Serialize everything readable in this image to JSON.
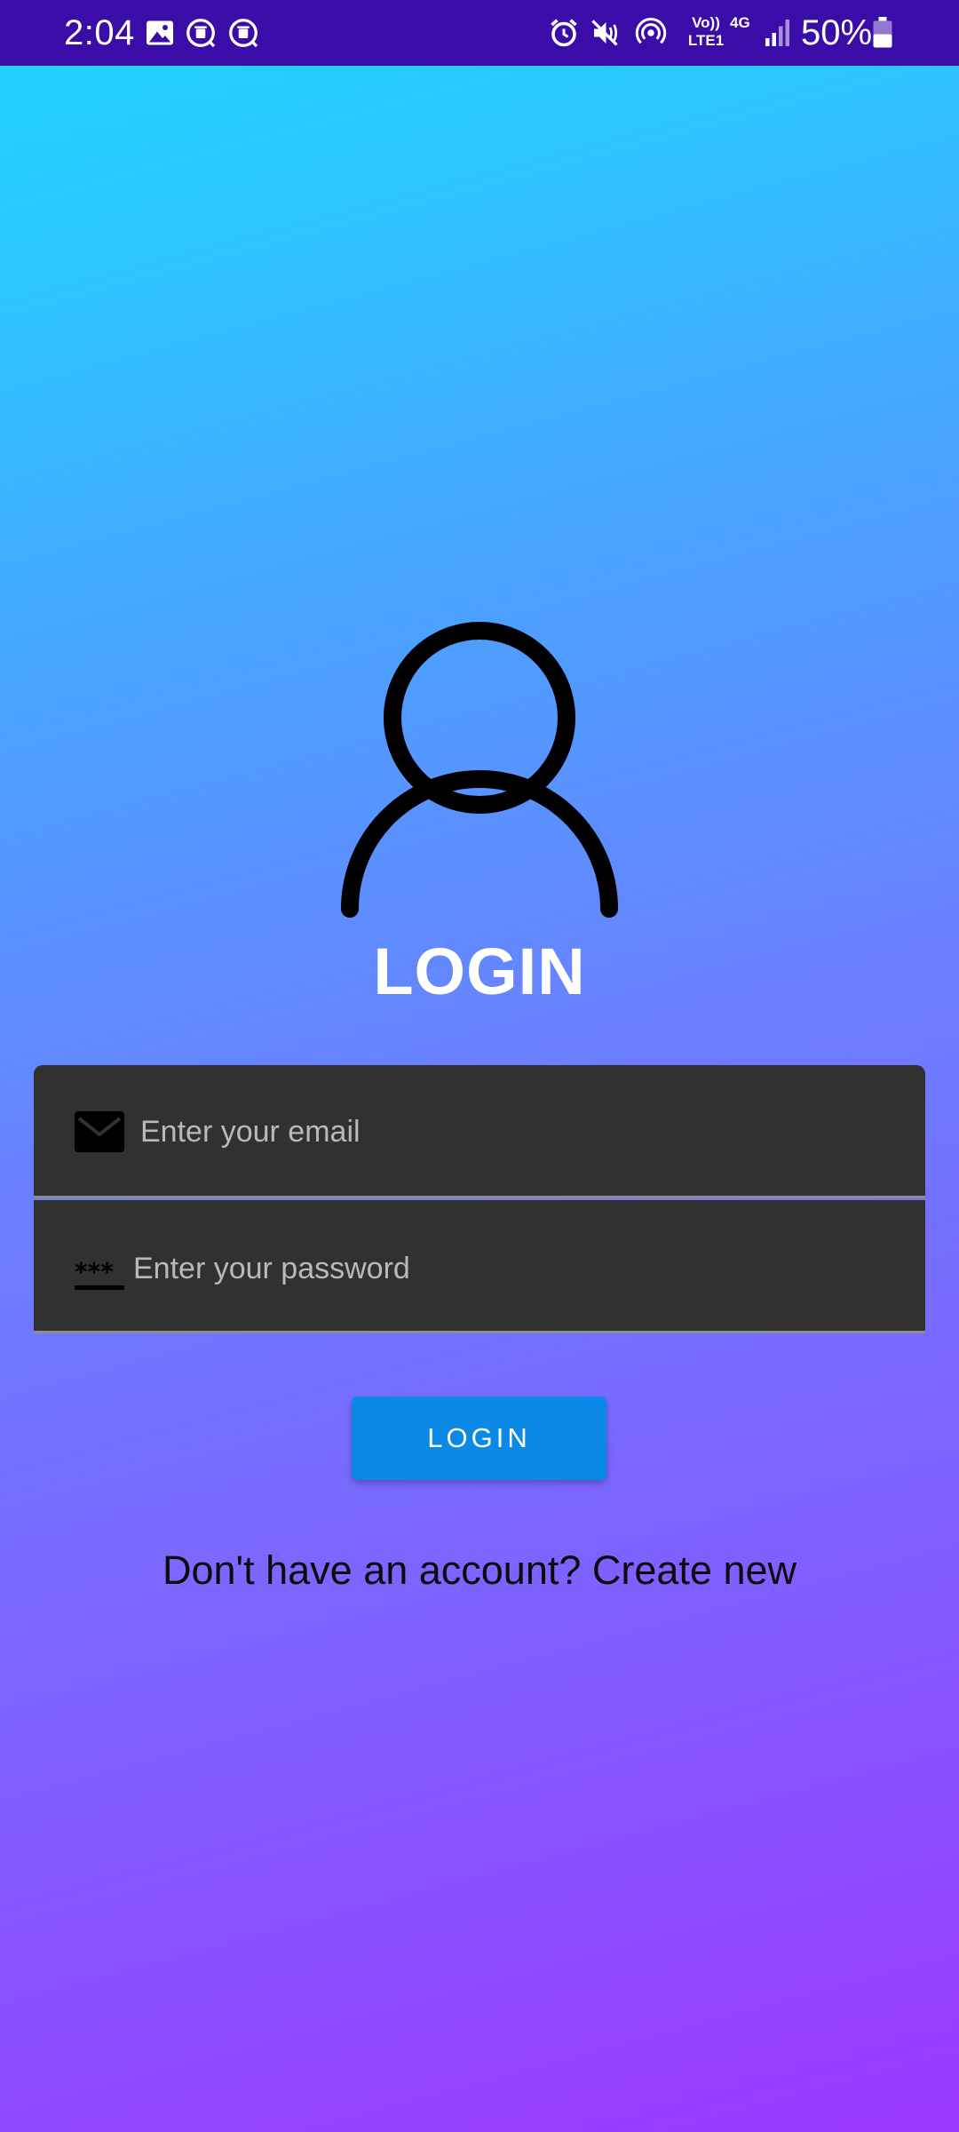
{
  "status_bar": {
    "time": "2:04",
    "battery_percent": "50%",
    "volte_label": "Vo)) LTE1",
    "network_label": "4G",
    "icons": [
      "image-icon",
      "notification-icon",
      "notification-icon",
      "alarm-icon",
      "mute-icon",
      "hotspot-icon",
      "volte-icon",
      "network-4g-icon",
      "signal-icon",
      "battery-icon"
    ],
    "battery_level": 0.5
  },
  "screen": {
    "title": "LOGIN",
    "avatar_icon": "user-icon"
  },
  "form": {
    "email": {
      "placeholder": "Enter your email",
      "value": "",
      "icon": "mail-icon"
    },
    "password": {
      "placeholder": "Enter your password",
      "value": "",
      "icon": "password-icon"
    },
    "submit_label": "LOGIN"
  },
  "signup_prompt": "Don't have an account? Create new",
  "colors": {
    "status_bar": "#3a0ca8",
    "gradient_top": "#1fd4ff",
    "gradient_bottom": "#9b38ff",
    "field_background": "#313131",
    "button": "#0a8ae6"
  }
}
